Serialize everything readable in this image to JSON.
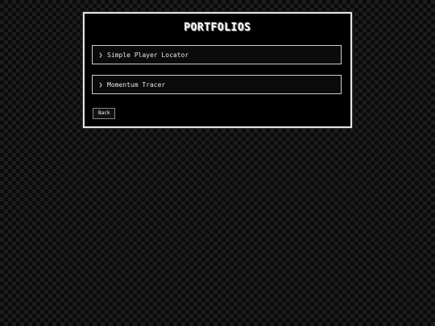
{
  "panel": {
    "title": "PORTFOLIOS",
    "items": [
      {
        "label": "Simple Player Locator",
        "icon": "chevron-right-icon",
        "glyph": "❯"
      },
      {
        "label": "Momentum Tracer",
        "icon": "chevron-right-icon",
        "glyph": "❯"
      }
    ],
    "back_label": "Back"
  },
  "colors": {
    "panel_bg": "#000000",
    "panel_border": "#e6e6e6",
    "text": "#ffffff"
  }
}
